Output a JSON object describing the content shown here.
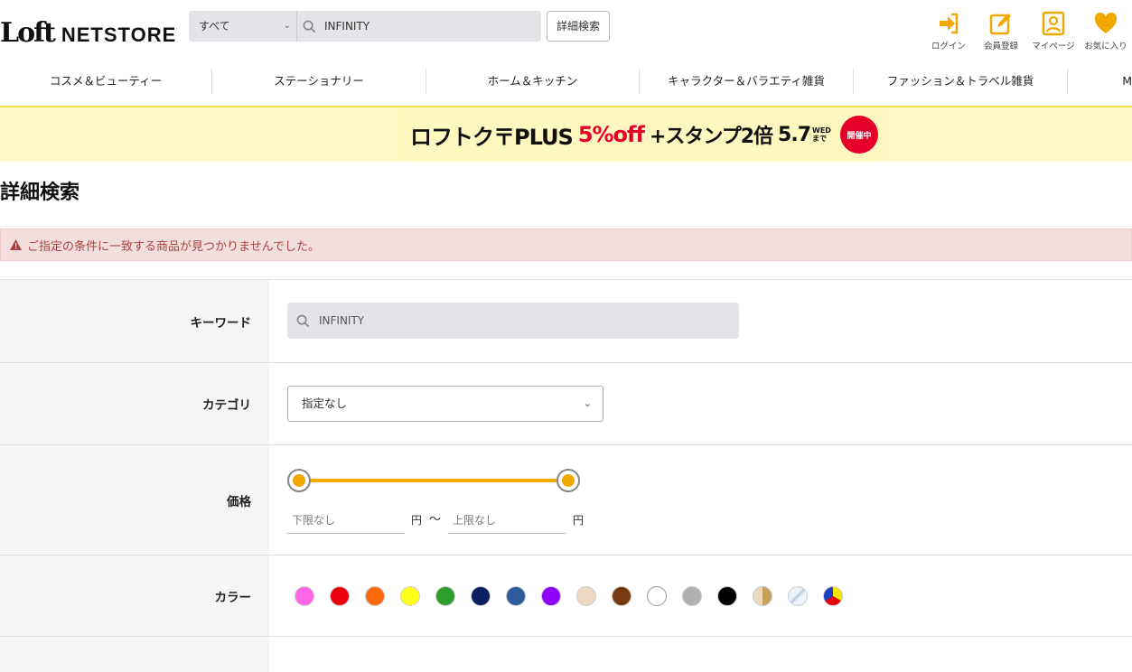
{
  "header": {
    "logo_mark": "Loft",
    "logo_text": "NETSTORE",
    "search_scope": "すべて",
    "search_query": "INFINITY",
    "advanced_search_button": "詳細検索",
    "icons": [
      {
        "name": "login-icon",
        "label": "ログイン"
      },
      {
        "name": "register-icon",
        "label": "会員登録"
      },
      {
        "name": "mypage-icon",
        "label": "マイページ"
      },
      {
        "name": "favorite-icon",
        "label": "お気に入り"
      }
    ],
    "accent_color": "#f1a800"
  },
  "nav": {
    "items": [
      "コスメ＆ビューティー",
      "ステーショナリー",
      "ホーム＆キッチン",
      "キャラクター＆バラエティ雑貨",
      "ファッション＆トラベル雑貨",
      "M"
    ]
  },
  "banner": {
    "part1": "ロフトク〒PLUS",
    "part2": "5%off",
    "part3": "+スタンプ2倍",
    "part4": "5.7",
    "part4_small_top": "WED",
    "part4_small_bottom": "まで",
    "badge": "開催中"
  },
  "page": {
    "title": "詳細検索",
    "alert": "ご指定の条件に一致する商品が見つかりませんでした。",
    "alert_color": "#a84242"
  },
  "form": {
    "keyword": {
      "label": "キーワード",
      "value": "INFINITY"
    },
    "category": {
      "label": "カテゴリ",
      "value": "指定なし"
    },
    "price": {
      "label": "価格",
      "min_placeholder": "下限なし",
      "max_placeholder": "上限なし",
      "unit": "円",
      "separator": "〜"
    },
    "color": {
      "label": "カラー",
      "swatches": [
        "#ff66e8",
        "#e8000b",
        "#ff6a0d",
        "#ffff19",
        "#2e9e2e",
        "#0a2060",
        "#2f5b9c",
        "#8d00ff",
        "#ead8c0",
        "#7a3a10",
        "#ffffff",
        "#b0b0b0",
        "#000000",
        "split-beige-gold",
        "silver-clear",
        "multicolor"
      ]
    }
  }
}
